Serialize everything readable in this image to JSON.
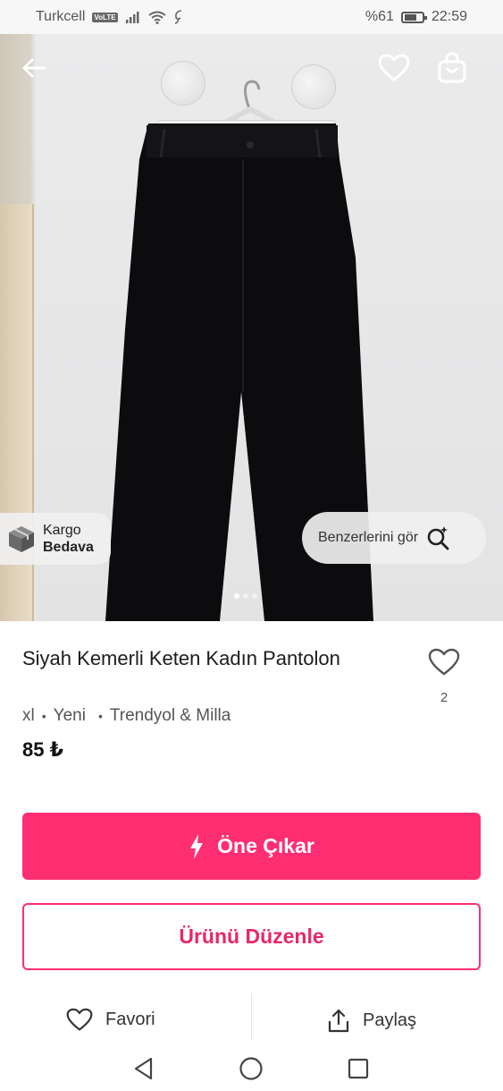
{
  "status_bar": {
    "carrier": "Turkcell",
    "volte": "VoLTE",
    "battery": "%61",
    "time": "22:59"
  },
  "hero": {
    "kargo_line1": "Kargo",
    "kargo_line2": "Bedava",
    "similar_label": "Benzerlerini gör",
    "image_count": 3,
    "active_image": 1
  },
  "product": {
    "title": "Siyah Kemerli Keten Kadın Pantolon",
    "size": "xl",
    "condition": "Yeni",
    "brand": "Trendyol & Milla",
    "price": "85 ₺",
    "favorite_count": "2"
  },
  "actions": {
    "promote_label": "Öne Çıkar",
    "edit_label": "Ürünü Düzenle",
    "favorite_label": "Favori",
    "share_label": "Paylaş"
  },
  "colors": {
    "accent": "#ff2e73"
  }
}
